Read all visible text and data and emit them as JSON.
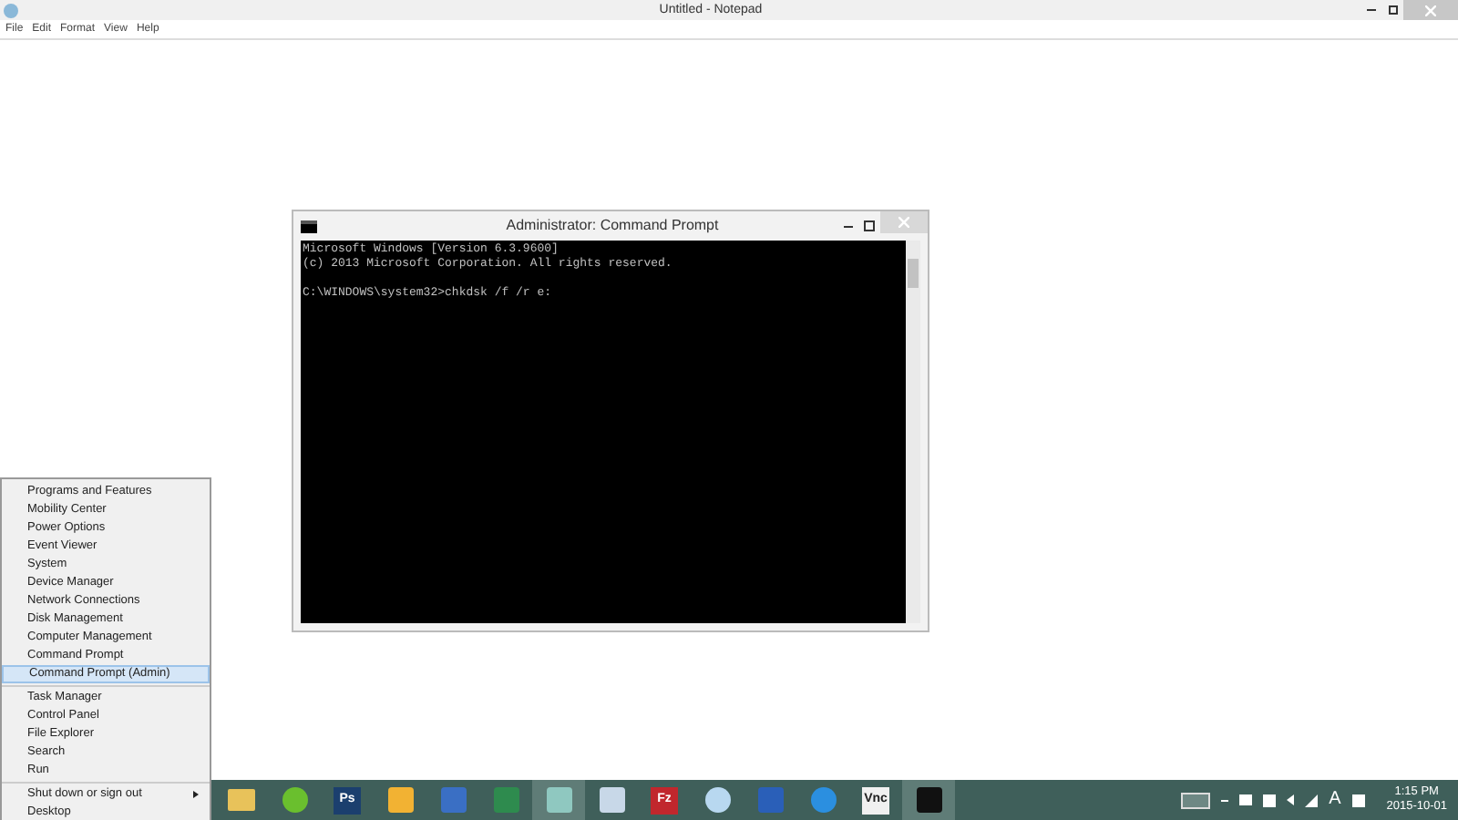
{
  "notepad": {
    "title": "Untitled - Notepad",
    "menu": [
      "File",
      "Edit",
      "Format",
      "View",
      "Help"
    ]
  },
  "cmd": {
    "title": "Administrator: Command Prompt",
    "paragraphs": [
      [
        "Microsoft Windows [Version 6.3.9600]",
        "(c) 2013 Microsoft Corporation. All rights reserved."
      ],
      [
        "C:\\WINDOWS\\system32>chkdsk /f /r e:"
      ]
    ]
  },
  "context_menu": {
    "groups": [
      [
        {
          "label": "Programs and Features",
          "selected": false
        },
        {
          "label": "Mobility Center",
          "selected": false
        },
        {
          "label": "Power Options",
          "selected": false
        },
        {
          "label": "Event Viewer",
          "selected": false
        },
        {
          "label": "System",
          "selected": false
        },
        {
          "label": "Device Manager",
          "selected": false
        },
        {
          "label": "Network Connections",
          "selected": false
        },
        {
          "label": "Disk Management",
          "selected": false
        },
        {
          "label": "Computer Management",
          "selected": false
        },
        {
          "label": "Command Prompt",
          "selected": false
        },
        {
          "label": "Command Prompt (Admin)",
          "selected": true
        }
      ],
      [
        {
          "label": "Task Manager",
          "selected": false
        },
        {
          "label": "Control Panel",
          "selected": false
        },
        {
          "label": "File Explorer",
          "selected": false
        },
        {
          "label": "Search",
          "selected": false
        },
        {
          "label": "Run",
          "selected": false
        }
      ],
      [
        {
          "label": "Shut down or sign out",
          "selected": false,
          "submenu": true
        },
        {
          "label": "Desktop",
          "selected": false
        }
      ]
    ]
  },
  "taskbar": {
    "apps": [
      {
        "kind": "folder",
        "color": "#e8c25a",
        "active": false
      },
      {
        "kind": "circle",
        "color": "#6abf2e",
        "active": false
      },
      {
        "kind": "text",
        "label": "Ps",
        "color": "#1b3f6e",
        "active": false
      },
      {
        "kind": "square",
        "color": "#f2b233",
        "active": false
      },
      {
        "kind": "square",
        "color": "#3a6fc4",
        "active": false
      },
      {
        "kind": "square",
        "color": "#2e8b4e",
        "active": false
      },
      {
        "kind": "square",
        "color": "#8fc8c0",
        "active": true
      },
      {
        "kind": "square",
        "color": "#c8d8e8",
        "active": false
      },
      {
        "kind": "text",
        "label": "Fz",
        "color": "#c1272d",
        "active": false
      },
      {
        "kind": "circle",
        "color": "#b8d8f0",
        "active": false
      },
      {
        "kind": "square",
        "color": "#2a5fb8",
        "active": false
      },
      {
        "kind": "circle",
        "color": "#2b8fe0",
        "active": false
      },
      {
        "kind": "text",
        "label": "Vnc",
        "color": "#f0f0f0",
        "active": false
      },
      {
        "kind": "square",
        "color": "#111111",
        "active": true
      }
    ],
    "ime": "A",
    "time": "1:15 PM",
    "date": "2015-10-01"
  }
}
